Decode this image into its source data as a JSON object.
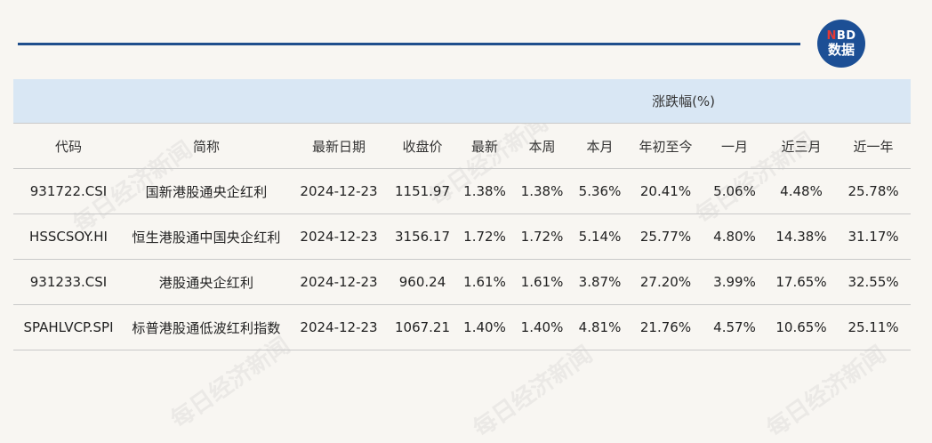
{
  "logo": {
    "brand_top_n": "N",
    "brand_top_rest": "BD",
    "brand_bottom": "数据"
  },
  "watermark": "每日经济新闻",
  "table": {
    "group_header": "涨跌幅(%)",
    "columns": [
      "代码",
      "简称",
      "最新日期",
      "收盘价",
      "最新",
      "本周",
      "本月",
      "年初至今",
      "一月",
      "近三月",
      "近一年"
    ],
    "rows": [
      [
        "931722.CSI",
        "国新港股通央企红利",
        "2024-12-23",
        "1151.97",
        "1.38%",
        "1.38%",
        "5.36%",
        "20.41%",
        "5.06%",
        "4.48%",
        "25.78%"
      ],
      [
        "HSSCSOY.HI",
        "恒生港股通中国央企红利",
        "2024-12-23",
        "3156.17",
        "1.72%",
        "1.72%",
        "5.14%",
        "25.77%",
        "4.80%",
        "14.38%",
        "31.17%"
      ],
      [
        "931233.CSI",
        "港股通央企红利",
        "2024-12-23",
        "960.24",
        "1.61%",
        "1.61%",
        "3.87%",
        "27.20%",
        "3.99%",
        "17.65%",
        "32.55%"
      ],
      [
        "SPAHLVCP.SPI",
        "标普港股通低波红利指数",
        "2024-12-23",
        "1067.21",
        "1.40%",
        "1.40%",
        "4.81%",
        "21.76%",
        "4.57%",
        "10.65%",
        "25.11%"
      ]
    ]
  }
}
